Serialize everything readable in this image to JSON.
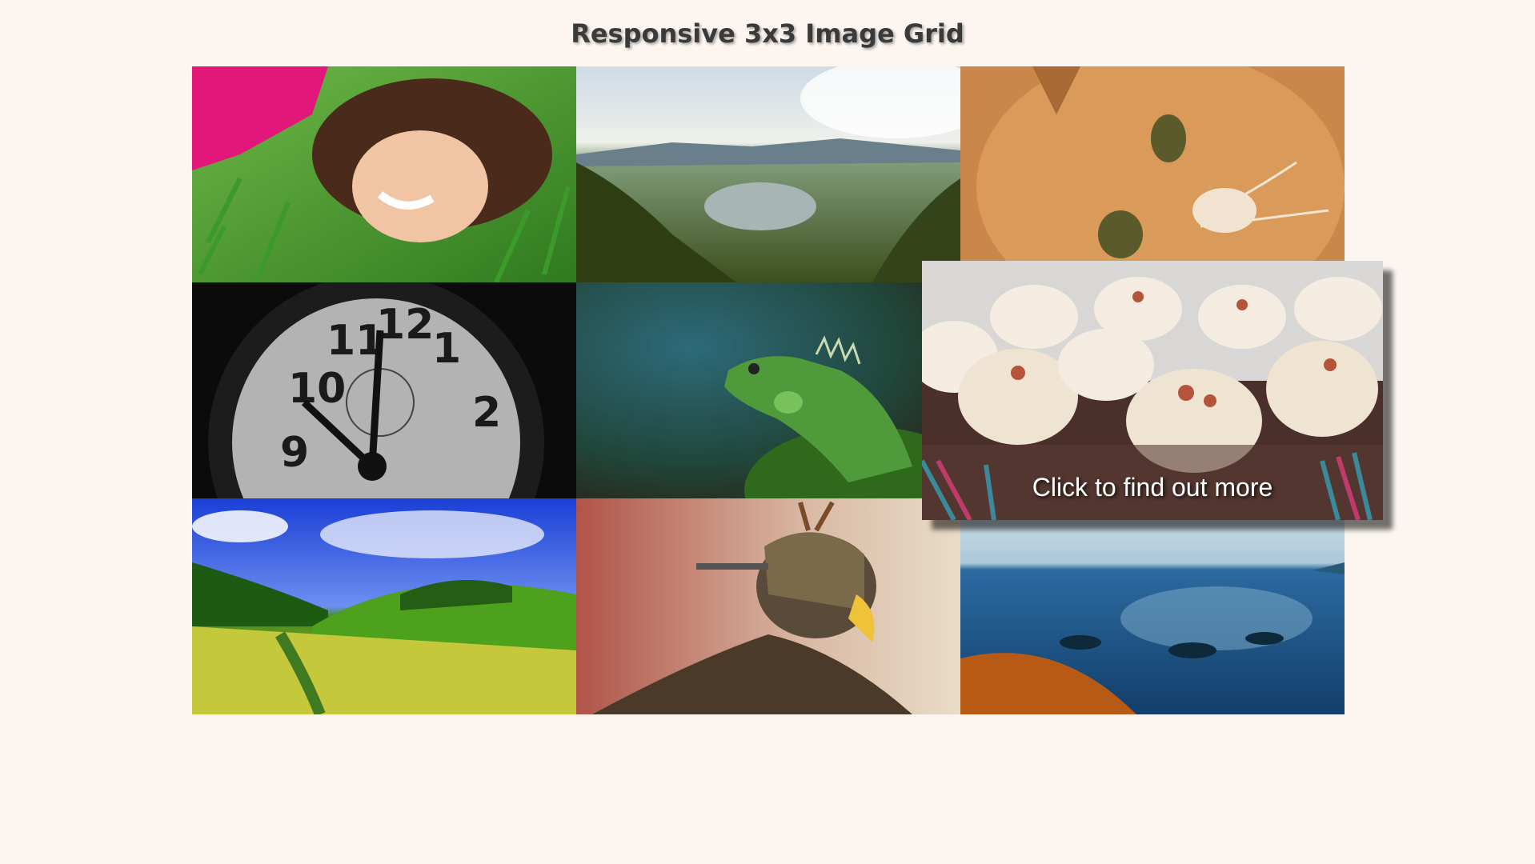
{
  "page": {
    "title": "Responsive 3x3 Image Grid",
    "background_color": "#fdf6f0"
  },
  "grid": {
    "tiles": [
      {
        "subject": "woman lying in grass"
      },
      {
        "subject": "misty forest lake landscape"
      },
      {
        "subject": "orange tabby kitten"
      },
      {
        "subject": "black and white alarm clock"
      },
      {
        "subject": "green iguana"
      },
      {
        "subject": "frosted cupcakes",
        "caption": "Click to find out more"
      },
      {
        "subject": "green hills under blue sky"
      },
      {
        "subject": "hooded falconry eagle"
      },
      {
        "subject": "ocean shoreline with rocks"
      }
    ]
  }
}
